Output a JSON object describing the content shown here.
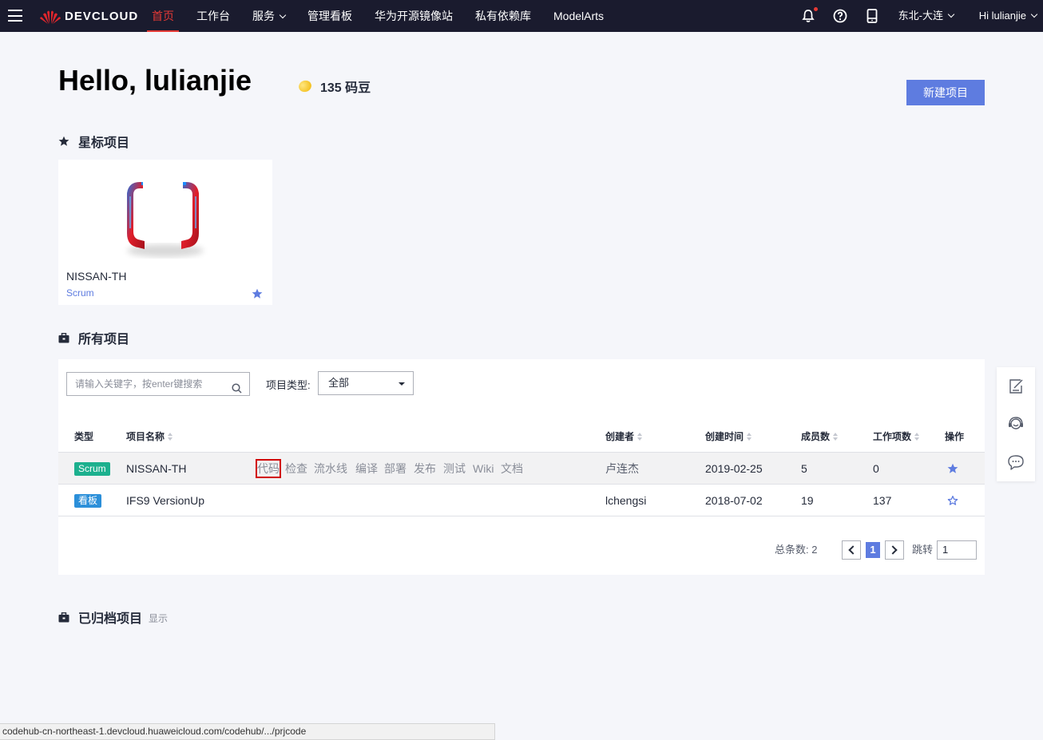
{
  "nav": {
    "brand": "DEVCLOUD",
    "items": [
      {
        "label": "首页",
        "active": true,
        "dropdown": false
      },
      {
        "label": "工作台",
        "active": false,
        "dropdown": false
      },
      {
        "label": "服务",
        "active": false,
        "dropdown": true
      },
      {
        "label": "管理看板",
        "active": false,
        "dropdown": false
      },
      {
        "label": "华为开源镜像站",
        "active": false,
        "dropdown": false
      },
      {
        "label": "私有依赖库",
        "active": false,
        "dropdown": false
      },
      {
        "label": "ModelArts",
        "active": false,
        "dropdown": false
      }
    ],
    "region": "东北-大连",
    "user_greeting": "Hi lulianjie",
    "icons": [
      "bell-icon",
      "help-icon",
      "mobile-icon"
    ]
  },
  "header": {
    "hello": "Hello, lulianjie",
    "beans": "135 码豆",
    "new_project_label": "新建项目"
  },
  "starred": {
    "title": "星标项目",
    "cards": [
      {
        "name": "NISSAN-TH",
        "type": "Scrum",
        "starred": true
      }
    ]
  },
  "all_projects": {
    "title": "所有项目",
    "search_placeholder": "请输入关键字，按enter键搜索",
    "type_filter_label": "项目类型:",
    "type_filter_value": "全部",
    "columns": [
      "类型",
      "项目名称",
      "创建者",
      "创建时间",
      "成员数",
      "工作项数",
      "操作"
    ],
    "rows": [
      {
        "type": "Scrum",
        "name": "NISSAN-TH",
        "quick_links": [
          "代码",
          "检查",
          "流水线",
          "编译",
          "部署",
          "发布",
          "测试",
          "Wiki",
          "文档"
        ],
        "creator": "卢连杰",
        "created": "2019-02-25",
        "members": "5",
        "work_items": "0",
        "starred": true
      },
      {
        "type": "看板",
        "name": "IFS9 VersionUp",
        "quick_links": [],
        "creator": "lchengsi",
        "created": "2018-07-02",
        "members": "19",
        "work_items": "137",
        "starred": false
      }
    ],
    "pagination": {
      "total_label": "总条数: 2",
      "current_page": "1",
      "jump_label": "跳转",
      "jump_value": "1"
    }
  },
  "archived": {
    "title": "已归档项目",
    "toggle_label": "显示"
  },
  "statusbar": {
    "url": "codehub-cn-northeast-1.devcloud.huaweicloud.com/codehub/.../prjcode"
  },
  "colors": {
    "accent": "#5e7ce0",
    "nav_bg": "#1a1b2e",
    "active_red": "#e53935",
    "scrum_tag": "#1cb08e",
    "kanban_tag": "#2b8fd9"
  }
}
